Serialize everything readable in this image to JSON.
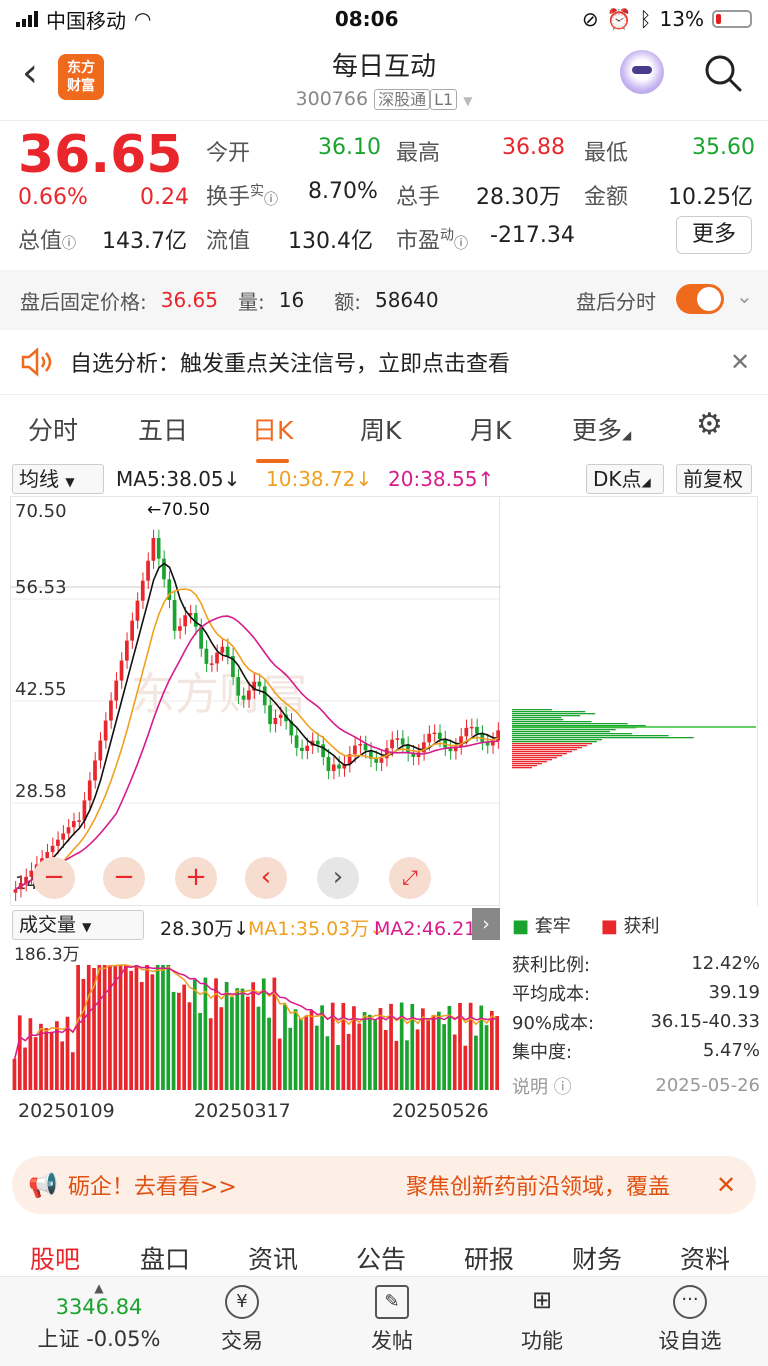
{
  "status_bar": {
    "carrier": "中国移动",
    "time": "08:06",
    "battery": "13%"
  },
  "header": {
    "logo_text_1": "东方",
    "logo_text_2": "财富",
    "title": "每日互动",
    "code": "300766",
    "tag_connect": "深股通",
    "tag_level": "L1"
  },
  "quote": {
    "price": "36.65",
    "change_pct": "0.66%",
    "change": "0.24",
    "fields": [
      {
        "label": "今开",
        "value": "36.10"
      },
      {
        "label": "最高",
        "value": "36.88"
      },
      {
        "label": "最低",
        "value": "35.60"
      },
      {
        "label": "换手",
        "sup": "实",
        "value": "8.70%"
      },
      {
        "label": "总手",
        "value": "28.30万"
      },
      {
        "label": "金额",
        "value": "10.25亿"
      },
      {
        "label": "总值",
        "value": "143.7亿"
      },
      {
        "label": "流值",
        "value": "130.4亿"
      },
      {
        "label": "市盈",
        "sup": "动",
        "value": "-217.34"
      }
    ],
    "more": "更多"
  },
  "after_hours": {
    "label": "盘后固定价格:",
    "price": "36.65",
    "qty_label": "量:",
    "qty": "16",
    "amt_label": "额:",
    "amt": "58640",
    "toggle_label": "盘后分时"
  },
  "alert": {
    "text": "自选分析：触发重点关注信号，立即点击查看"
  },
  "chart_tabs": [
    "分时",
    "五日",
    "日K",
    "周K",
    "月K",
    "更多"
  ],
  "active_tab": "日K",
  "ma_bar": {
    "selector": "均线",
    "ma5": "MA5:38.05",
    "ma10": "10:38.72",
    "ma20": "20:38.55",
    "dk": "DK点",
    "adjust": "前复权"
  },
  "price_axis": [
    "70.50",
    "56.53",
    "42.55",
    "28.58",
    "14.60"
  ],
  "peak_label": "70.50",
  "watermark": "东方财富",
  "volume_bar": {
    "selector": "成交量",
    "vol": "28.30万",
    "ma1": "MA1:35.03万",
    "ma2": "MA2:46.21万",
    "axis_top": "186.3万"
  },
  "dates": [
    "20250109",
    "20250317",
    "20250526"
  ],
  "chips": {
    "legend_trap": "套牢",
    "legend_profit": "获利",
    "rows": [
      {
        "label": "获利比例:",
        "value": "12.42%"
      },
      {
        "label": "平均成本:",
        "value": "39.19"
      },
      {
        "label": "90%成本:",
        "value": "36.15-40.33"
      },
      {
        "label": "集中度:",
        "value": "5.47%"
      }
    ],
    "note": "说明",
    "date": "2025-05-26"
  },
  "banner": {
    "left": "砺企！去看看>>",
    "right": "聚焦创新药前沿领域，覆盖"
  },
  "bottom_tabs": [
    "股吧",
    "盘口",
    "资讯",
    "公告",
    "研报",
    "财务",
    "资料"
  ],
  "footer": {
    "index_value": "3346.84",
    "index_name": "上证 -0.05%",
    "items": [
      "交易",
      "发帖",
      "功能",
      "设自选"
    ]
  },
  "colors": {
    "up": "#e8262b",
    "down": "#1aa32f",
    "accent": "#f06a1e",
    "ma5": "#111111",
    "ma10": "#f0a020",
    "ma20": "#d81b8c"
  }
}
